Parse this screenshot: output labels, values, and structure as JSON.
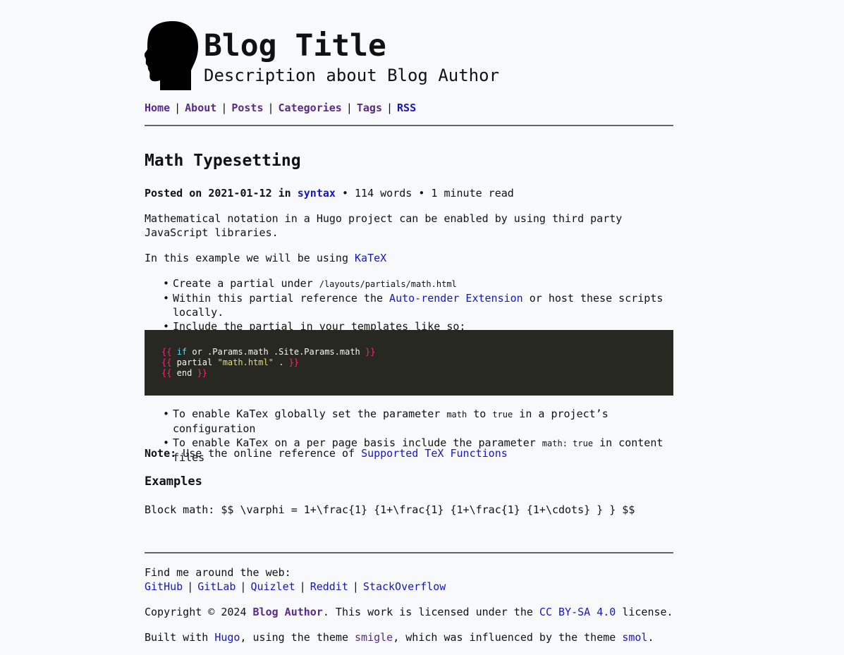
{
  "header": {
    "title": "Blog Title",
    "description": "Description about Blog Author"
  },
  "nav": {
    "items": [
      {
        "label": "Home"
      },
      {
        "label": "About"
      },
      {
        "label": "Posts"
      },
      {
        "label": "Categories"
      },
      {
        "label": "Tags"
      },
      {
        "label": "RSS"
      }
    ],
    "separator": "|"
  },
  "post": {
    "title": "Math Typesetting",
    "meta": {
      "posted_on_label": "Posted on",
      "date": "2021-01-12",
      "in_label": "in",
      "category": "syntax",
      "words": "114 words",
      "read_time": "1 minute read",
      "dot": "•"
    },
    "intro": "Mathematical notation in a Hugo project can be enabled by using third party JavaScript libraries.",
    "example_prefix": "In this example we will be using ",
    "example_link": "KaTeX",
    "steps": {
      "step1_text": "Create a partial under ",
      "step1_code": "/layouts/partials/math.html",
      "step2_prefix": "Within this partial reference the ",
      "step2_link": "Auto-render Extension",
      "step2_suffix": " or host these scripts locally.",
      "step3_text": "Include the partial in your templates like so:"
    },
    "code": {
      "line1": {
        "open": "{{",
        "kw": "if",
        "rest": " or .Params.math .Site.Params.math ",
        "close": "}}"
      },
      "line2": {
        "open": "{{",
        "pre": " partial ",
        "str": "\"math.html\"",
        "rest": " . ",
        "close": "}}"
      },
      "line3": {
        "open": "{{",
        "rest": " end ",
        "close": "}}"
      }
    },
    "enable": {
      "global_prefix": "To enable KaTex globally set the parameter ",
      "global_code1": "math",
      "global_mid": " to ",
      "global_code2": "true",
      "global_suffix": " in a project’s configuration",
      "page_prefix": "To enable KaTex on a per page basis include the parameter ",
      "page_code": "math: true",
      "page_suffix": " in content files"
    },
    "note_label": "Note:",
    "note_text": " Use the online reference of ",
    "note_link": "Supported TeX Functions",
    "examples_heading": "Examples",
    "block_math": "Block math: $$ \\varphi = 1+\\frac{1} {1+\\frac{1} {1+\\frac{1} {1+\\cdots} } } $$"
  },
  "footer": {
    "find_me": "Find me around the web:",
    "links": [
      "GitHub",
      "GitLab",
      "Quizlet",
      "Reddit",
      "StackOverflow"
    ],
    "copyright_prefix": "Copyright © 2024 ",
    "author": "Blog Author",
    "license_prefix": ". This work is licensed under the ",
    "license_link": "CC BY-SA 4.0",
    "license_suffix": " license.",
    "built_prefix": "Built with ",
    "hugo_link": "Hugo",
    "theme_mid": ", using the theme ",
    "theme_link": "smigle",
    "influenced_mid": ", which was influenced by the theme ",
    "smol_link": "smol",
    "end": "."
  },
  "colors": {
    "background": "#f8f9fa",
    "visited_link": "#5a2a8a",
    "link": "#1515c8",
    "code_bg": "#272822"
  }
}
